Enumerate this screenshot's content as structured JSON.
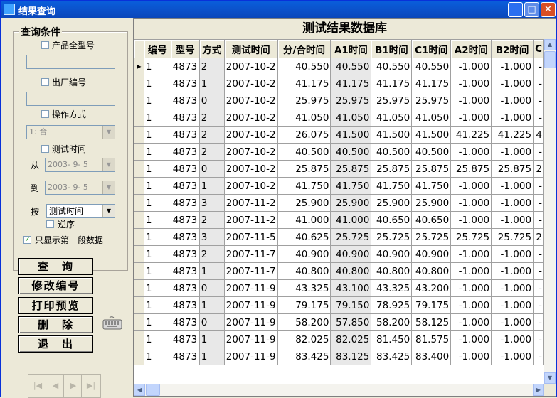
{
  "window": {
    "title": "结果查询",
    "minimize": "_",
    "maximize": "□",
    "close": "✕"
  },
  "query": {
    "group_title": "查询条件",
    "full_model_label": "产品全型号",
    "full_model_value": "",
    "factory_no_label": "出厂编号",
    "factory_no_value": "",
    "op_mode_label": "操作方式",
    "op_mode_value": "1: 合",
    "test_time_label": "测试时间",
    "from_label": "从",
    "from_value": "2003- 9- 5",
    "to_label": "到",
    "to_value": "2003- 9- 5",
    "sort_label": "按",
    "sort_value": "测试时间",
    "reverse_label": "逆序",
    "first_seg_label": "只显示第一段数据",
    "first_seg_checked": "✓"
  },
  "buttons": {
    "query": "查　询",
    "edit_no": "修改编号",
    "print_preview": "打印预览",
    "delete": "删　除",
    "exit": "退　出"
  },
  "nav": {
    "first": "|◀",
    "prev": "◀",
    "next": "▶",
    "last": "▶|"
  },
  "grid": {
    "title": "测试结果数据库",
    "columns": [
      "编号",
      "型号",
      "方式",
      "测试时间",
      "分/合时间",
      "A1时间",
      "B1时间",
      "C1时间",
      "A2时间",
      "B2时间",
      "C"
    ],
    "rows": [
      [
        "1",
        "4873",
        "2",
        "2007-10-2",
        "40.550",
        "40.550",
        "40.550",
        "40.550",
        "-1.000",
        "-1.000",
        "-"
      ],
      [
        "1",
        "4873",
        "1",
        "2007-10-2",
        "41.175",
        "41.175",
        "41.175",
        "41.175",
        "-1.000",
        "-1.000",
        "-"
      ],
      [
        "1",
        "4873",
        "0",
        "2007-10-2",
        "25.975",
        "25.975",
        "25.975",
        "25.975",
        "-1.000",
        "-1.000",
        "-"
      ],
      [
        "1",
        "4873",
        "2",
        "2007-10-2",
        "41.050",
        "41.050",
        "41.050",
        "41.050",
        "-1.000",
        "-1.000",
        "-"
      ],
      [
        "1",
        "4873",
        "2",
        "2007-10-2",
        "26.075",
        "41.500",
        "41.500",
        "41.500",
        "41.225",
        "41.225",
        "4"
      ],
      [
        "1",
        "4873",
        "2",
        "2007-10-2",
        "40.500",
        "40.500",
        "40.500",
        "40.500",
        "-1.000",
        "-1.000",
        "-"
      ],
      [
        "1",
        "4873",
        "0",
        "2007-10-2",
        "25.875",
        "25.875",
        "25.875",
        "25.875",
        "25.875",
        "25.875",
        "2"
      ],
      [
        "1",
        "4873",
        "1",
        "2007-10-2",
        "41.750",
        "41.750",
        "41.750",
        "41.750",
        "-1.000",
        "-1.000",
        "-"
      ],
      [
        "1",
        "4873",
        "3",
        "2007-11-2",
        "25.900",
        "25.900",
        "25.900",
        "25.900",
        "-1.000",
        "-1.000",
        "-"
      ],
      [
        "1",
        "4873",
        "2",
        "2007-11-2",
        "41.000",
        "41.000",
        "40.650",
        "40.650",
        "-1.000",
        "-1.000",
        "-"
      ],
      [
        "1",
        "4873",
        "3",
        "2007-11-5",
        "40.625",
        "25.725",
        "25.725",
        "25.725",
        "25.725",
        "25.725",
        "2"
      ],
      [
        "1",
        "4873",
        "2",
        "2007-11-7",
        "40.900",
        "40.900",
        "40.900",
        "40.900",
        "-1.000",
        "-1.000",
        "-"
      ],
      [
        "1",
        "4873",
        "1",
        "2007-11-7",
        "40.800",
        "40.800",
        "40.800",
        "40.800",
        "-1.000",
        "-1.000",
        "-"
      ],
      [
        "1",
        "4873",
        "0",
        "2007-11-9",
        "43.325",
        "43.100",
        "43.325",
        "43.200",
        "-1.000",
        "-1.000",
        "-"
      ],
      [
        "1",
        "4873",
        "1",
        "2007-11-9",
        "79.175",
        "79.150",
        "78.925",
        "79.175",
        "-1.000",
        "-1.000",
        "-"
      ],
      [
        "1",
        "4873",
        "0",
        "2007-11-9",
        "58.200",
        "57.850",
        "58.200",
        "58.125",
        "-1.000",
        "-1.000",
        "-"
      ],
      [
        "1",
        "4873",
        "1",
        "2007-11-9",
        "82.025",
        "82.025",
        "81.450",
        "81.575",
        "-1.000",
        "-1.000",
        "-"
      ],
      [
        "1",
        "4873",
        "1",
        "2007-11-9",
        "83.425",
        "83.125",
        "83.425",
        "83.400",
        "-1.000",
        "-1.000",
        "-"
      ]
    ],
    "current_row_marker": "▶"
  },
  "scroll": {
    "up": "▲",
    "down": "▼",
    "left": "◀",
    "right": "▶"
  }
}
